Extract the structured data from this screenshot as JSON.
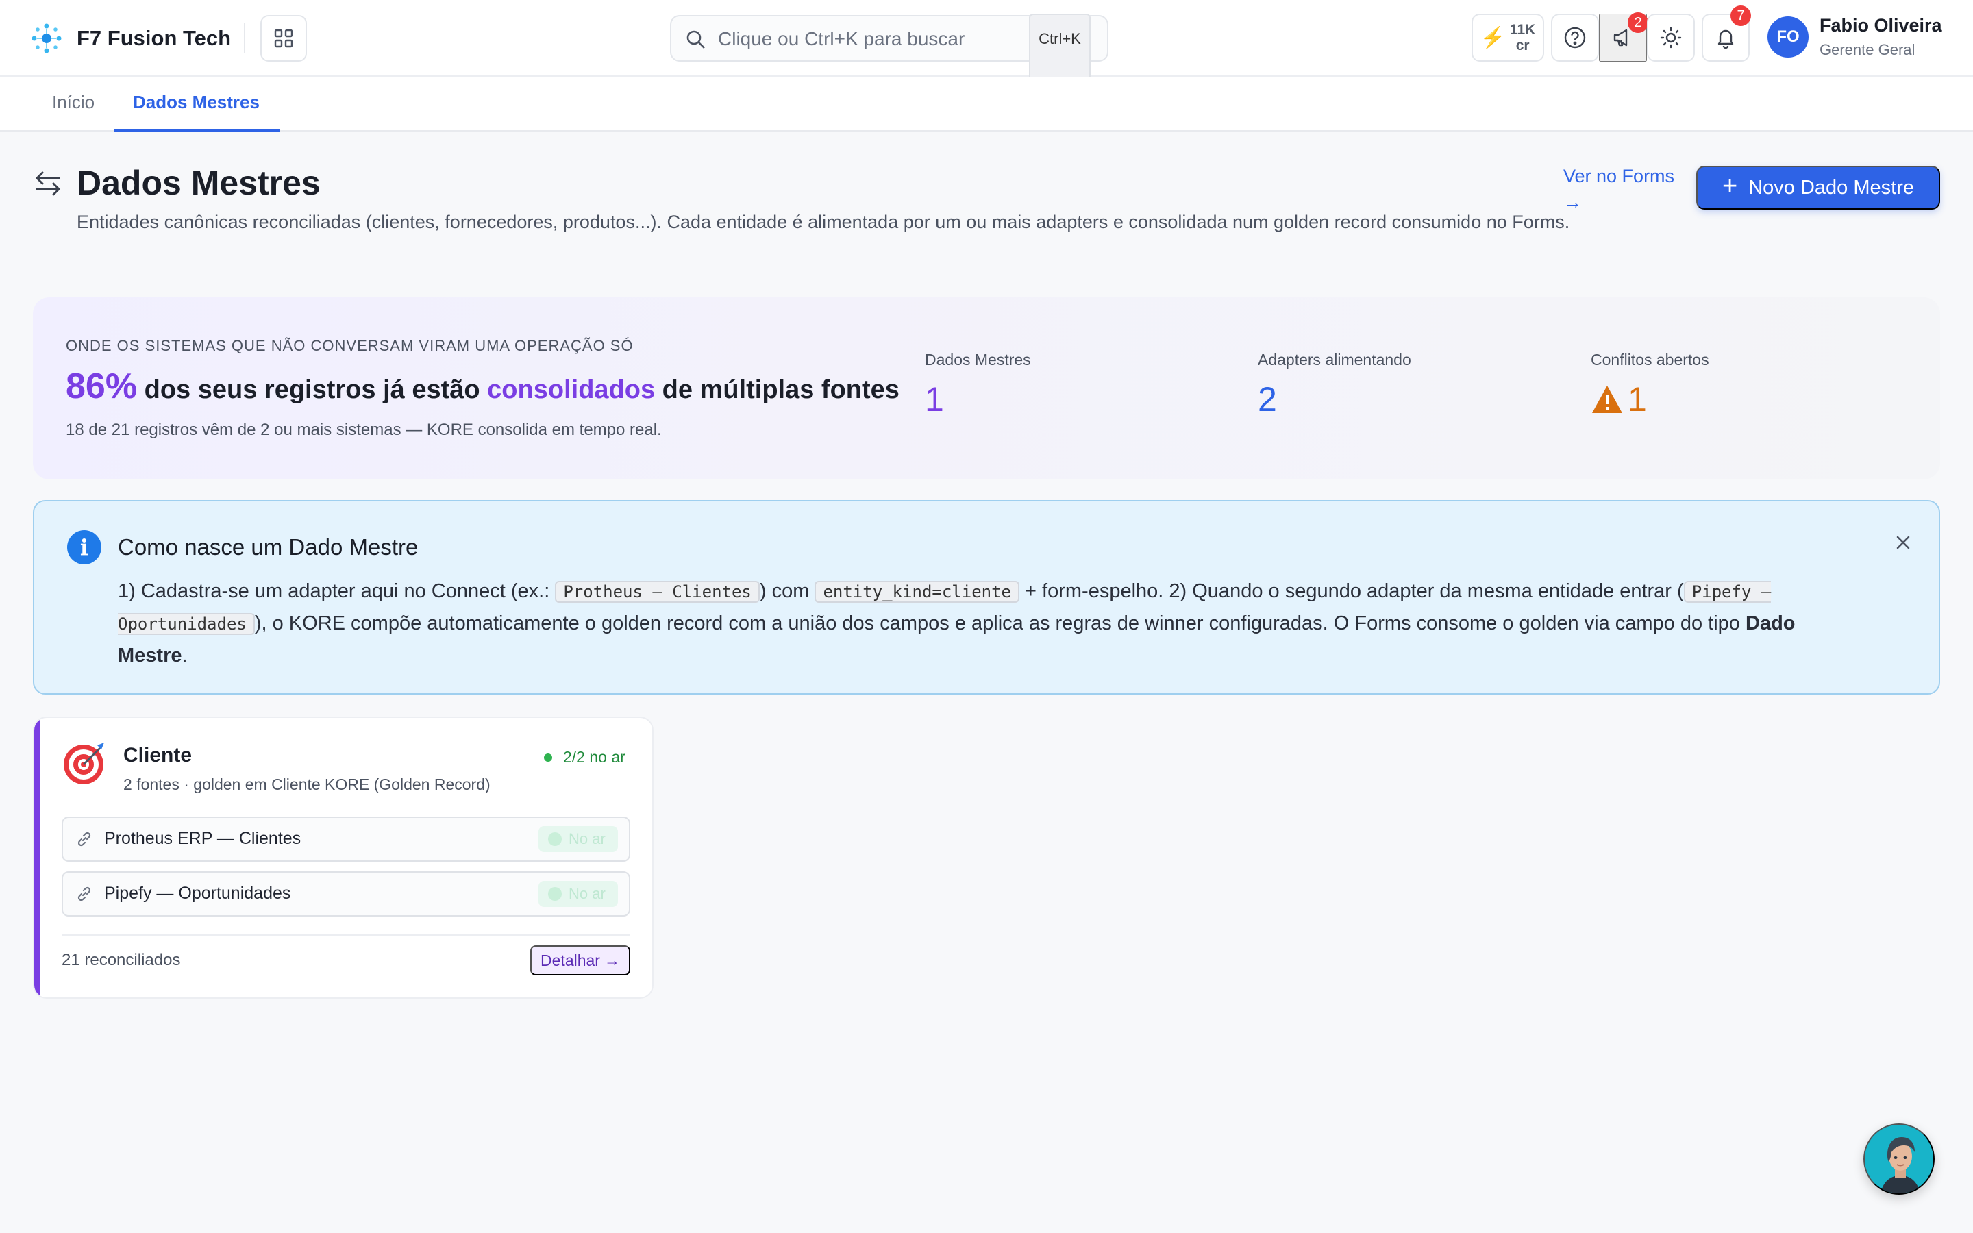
{
  "app": {
    "brand": "F7 Fusion Tech",
    "accent": "#2e63e6",
    "purple": "#7a3ee3"
  },
  "header": {
    "search_placeholder": "Clique ou Ctrl+K para buscar",
    "search_shortcut": "Ctrl+K",
    "credits_value": "11K",
    "credits_unit": "cr",
    "announcements_badge": "2",
    "notifications_badge": "7",
    "user": {
      "initials": "FO",
      "name": "Fabio Oliveira",
      "role": "Gerente Geral"
    }
  },
  "tabs": [
    {
      "label": "Início",
      "active": false
    },
    {
      "label": "Dados Mestres",
      "active": true
    }
  ],
  "page": {
    "title": "Dados Mestres",
    "description": "Entidades canônicas reconciliadas (clientes, fornecedores, produtos...). Cada entidade é alimentada por um ou mais adapters e consolidada num golden record consumido no Forms.",
    "link_forms": "Ver no Forms →",
    "new_button": "Novo Dado Mestre"
  },
  "hero": {
    "eyebrow": "ONDE OS SISTEMAS QUE NÃO CONVERSAM VIRAM UMA OPERAÇÃO SÓ",
    "percent": "86%",
    "headline_a": " dos seus registros já estão ",
    "headline_highlight": "consolidados",
    "headline_b": " de múltiplas fontes",
    "sub": "18 de 21 registros vêm de 2 ou mais sistemas — KORE consolida em tempo real.",
    "stats": [
      {
        "label": "Dados Mestres",
        "value": "1"
      },
      {
        "label": "Adapters alimentando",
        "value": "2"
      },
      {
        "label": "Conflitos abertos",
        "value": "1"
      }
    ]
  },
  "info": {
    "title": "Como nasce um Dado Mestre",
    "t1": "1) Cadastra-se um adapter aqui no Connect (ex.: ",
    "code1": "Protheus — Clientes",
    "t2": ") com ",
    "code2": "entity_kind=cliente",
    "t3": " + form-espelho. 2) Quando o segundo adapter da mesma entidade entrar (",
    "code3": "Pipefy — Oportunidades",
    "t4": "), o KORE compõe automaticamente o golden record com a união dos campos e aplica as regras de winner configuradas. O Forms consome o golden via campo do tipo ",
    "bold": "Dado Mestre",
    "t5": "."
  },
  "entities": [
    {
      "name": "Cliente",
      "subtitle": "2 fontes · golden em Cliente KORE (Golden Record)",
      "status": "2/2 no ar",
      "sources": [
        {
          "name": "Protheus ERP — Clientes",
          "state": "No ar"
        },
        {
          "name": "Pipefy — Oportunidades",
          "state": "No ar"
        }
      ],
      "reconciled": "21 reconciliados",
      "detail_label": "Detalhar"
    }
  ]
}
